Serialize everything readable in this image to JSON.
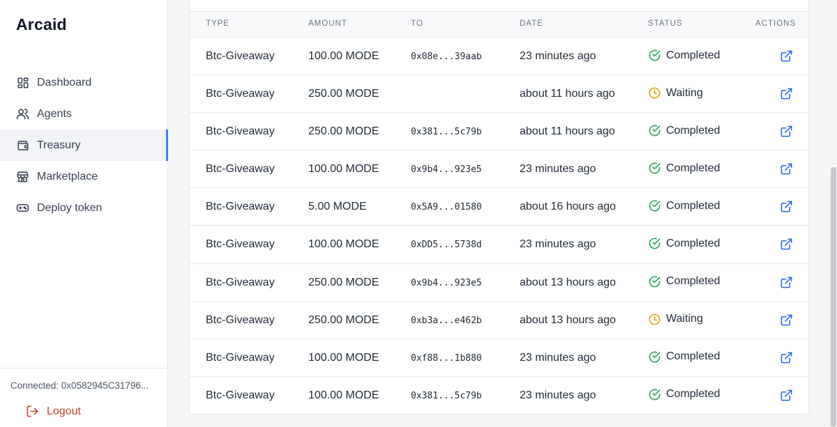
{
  "app": {
    "name": "Arcaid"
  },
  "sidebar": {
    "items": [
      {
        "label": "Dashboard",
        "icon": "dashboard-icon",
        "active": false
      },
      {
        "label": "Agents",
        "icon": "users-icon",
        "active": false
      },
      {
        "label": "Treasury",
        "icon": "wallet-icon",
        "active": true
      },
      {
        "label": "Marketplace",
        "icon": "store-icon",
        "active": false
      },
      {
        "label": "Deploy token",
        "icon": "gamepad-icon",
        "active": false
      }
    ],
    "connected": "Connected: 0x0582945C31796...",
    "logout": "Logout"
  },
  "table": {
    "headers": [
      "TYPE",
      "AMOUNT",
      "TO",
      "DATE",
      "STATUS",
      "ACTIONS"
    ],
    "rows": [
      {
        "type": "Btc-Giveaway",
        "amount": "100.00 MODE",
        "to": "0x08e...39aab",
        "date": "23 minutes ago",
        "status": "Completed"
      },
      {
        "type": "Btc-Giveaway",
        "amount": "250.00 MODE",
        "to": "",
        "date": "about 11 hours ago",
        "status": "Waiting"
      },
      {
        "type": "Btc-Giveaway",
        "amount": "250.00 MODE",
        "to": "0x381...5c79b",
        "date": "about 11 hours ago",
        "status": "Completed"
      },
      {
        "type": "Btc-Giveaway",
        "amount": "100.00 MODE",
        "to": "0x9b4...923e5",
        "date": "23 minutes ago",
        "status": "Completed"
      },
      {
        "type": "Btc-Giveaway",
        "amount": "5.00 MODE",
        "to": "0x5A9...01580",
        "date": "about 16 hours ago",
        "status": "Completed"
      },
      {
        "type": "Btc-Giveaway",
        "amount": "100.00 MODE",
        "to": "0xDD5...5738d",
        "date": "23 minutes ago",
        "status": "Completed"
      },
      {
        "type": "Btc-Giveaway",
        "amount": "250.00 MODE",
        "to": "0x9b4...923e5",
        "date": "about 13 hours ago",
        "status": "Completed"
      },
      {
        "type": "Btc-Giveaway",
        "amount": "250.00 MODE",
        "to": "0xb3a...e462b",
        "date": "about 13 hours ago",
        "status": "Waiting"
      },
      {
        "type": "Btc-Giveaway",
        "amount": "100.00 MODE",
        "to": "0xf88...1b880",
        "date": "23 minutes ago",
        "status": "Completed"
      },
      {
        "type": "Btc-Giveaway",
        "amount": "100.00 MODE",
        "to": "0x381...5c79b",
        "date": "23 minutes ago",
        "status": "Completed"
      }
    ]
  },
  "colors": {
    "accent": "#3b82f6",
    "completed": "#22a559",
    "waiting": "#e0a100",
    "logout": "#c2412b",
    "action_icon": "#2563eb"
  }
}
